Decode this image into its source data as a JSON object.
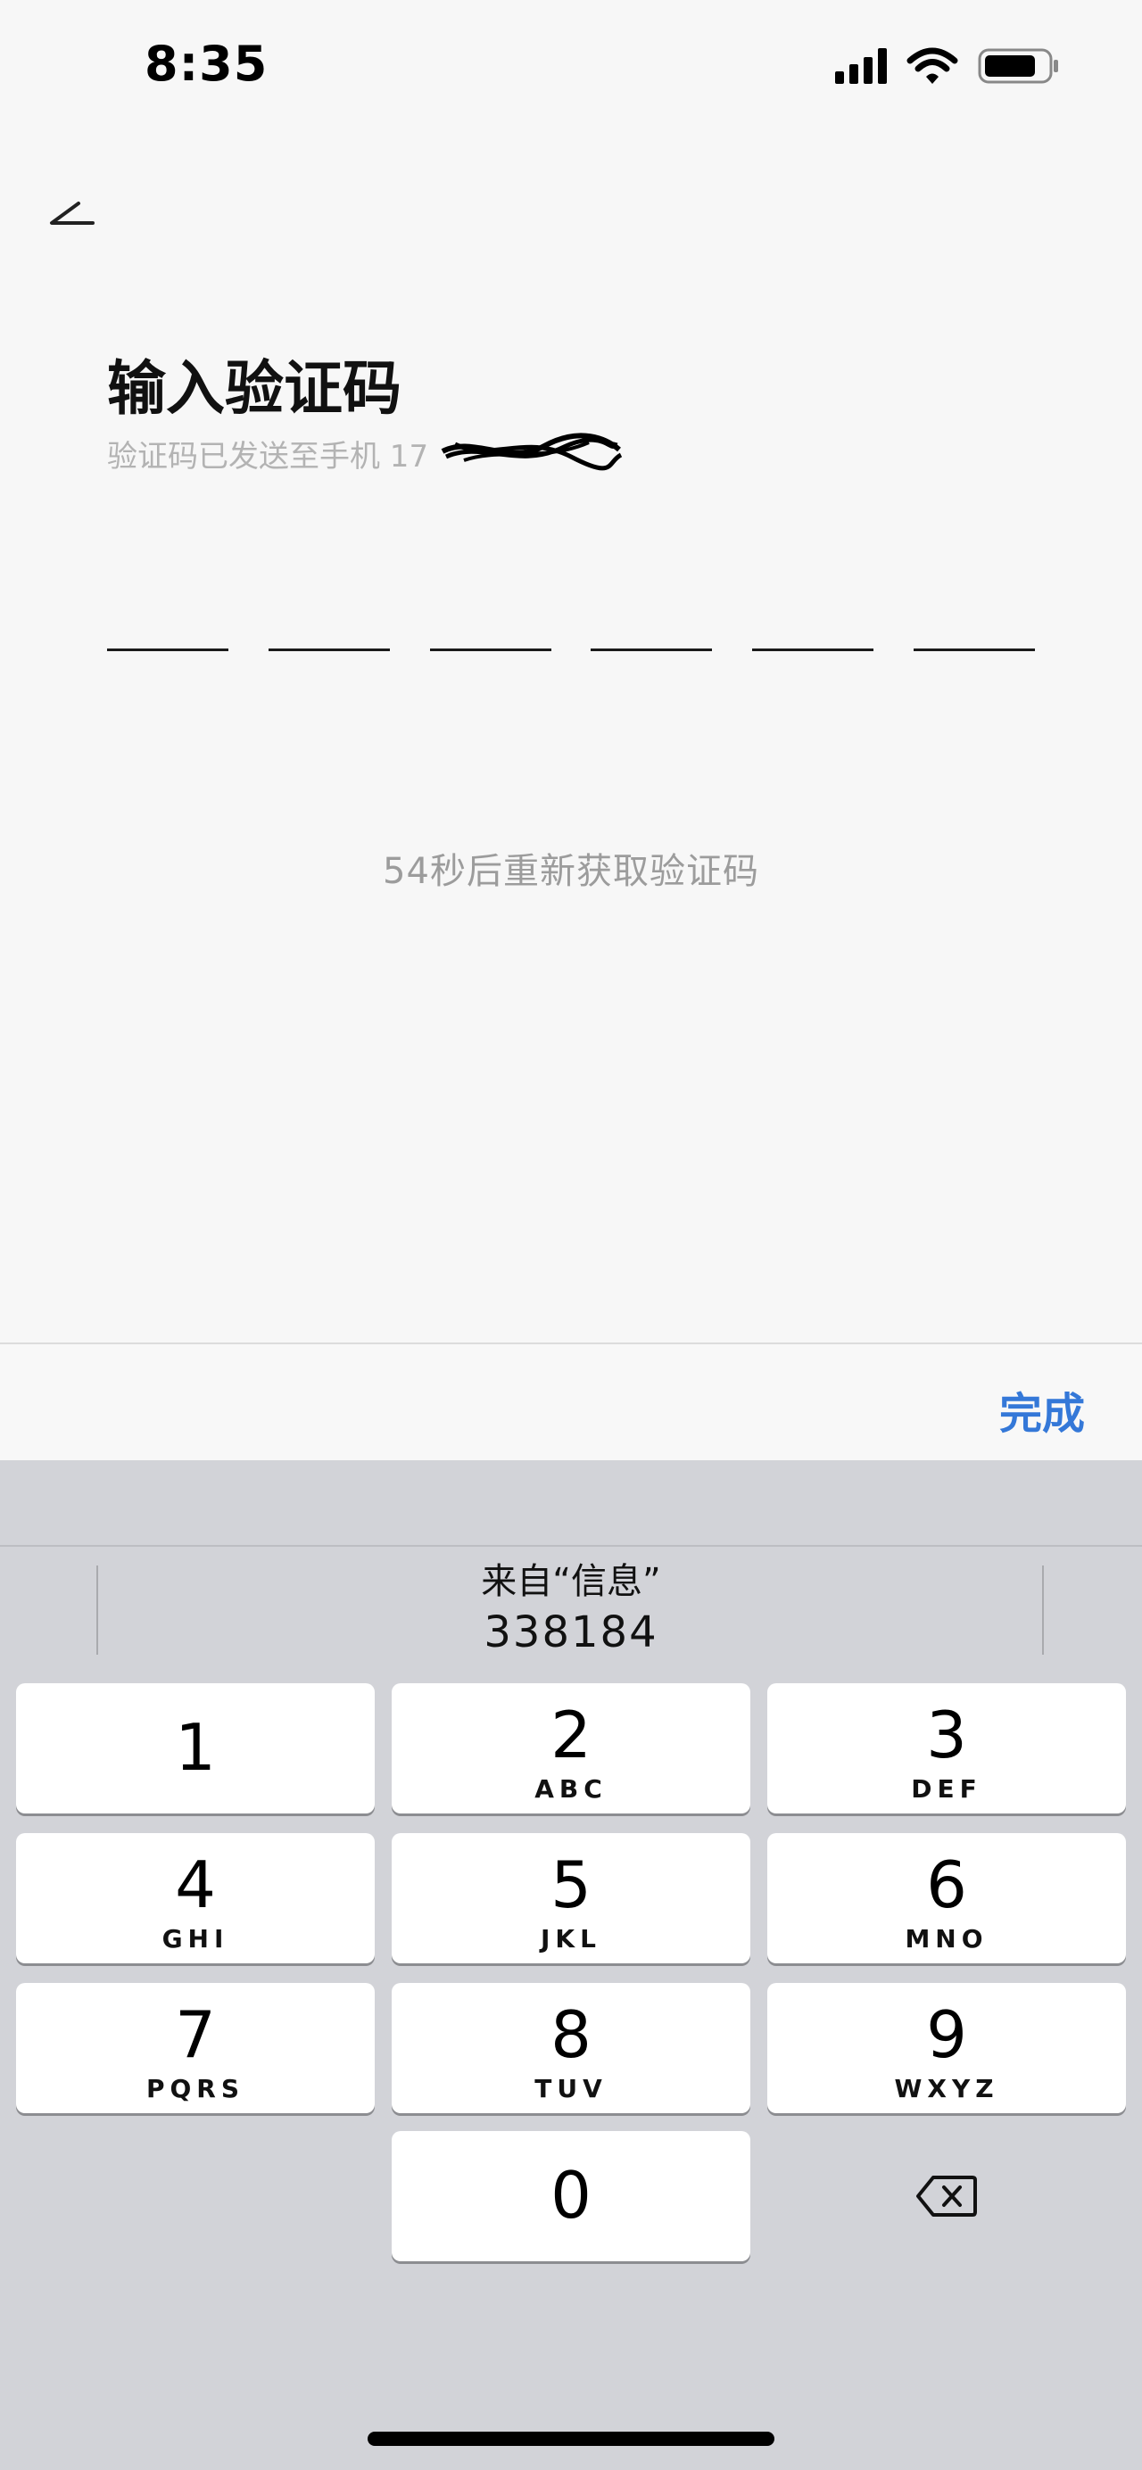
{
  "status_bar": {
    "time": "8:35"
  },
  "header": {
    "back_label": "<"
  },
  "page": {
    "title": "输入验证码",
    "subtitle": "验证码已发送至手机 17",
    "code_slot_count": 6,
    "resend_text": "54秒后重新获取验证码"
  },
  "toolbar": {
    "done_label": "完成"
  },
  "keyboard": {
    "suggestion_source": "来自“信息”",
    "suggestion_code": "338184",
    "keys": [
      {
        "num": "1",
        "letters": ""
      },
      {
        "num": "2",
        "letters": "ABC"
      },
      {
        "num": "3",
        "letters": "DEF"
      },
      {
        "num": "4",
        "letters": "GHI"
      },
      {
        "num": "5",
        "letters": "JKL"
      },
      {
        "num": "6",
        "letters": "MNO"
      },
      {
        "num": "7",
        "letters": "PQRS"
      },
      {
        "num": "8",
        "letters": "TUV"
      },
      {
        "num": "9",
        "letters": "WXYZ"
      },
      {
        "num": "0",
        "letters": ""
      }
    ],
    "delete_icon": "backspace-icon"
  },
  "colors": {
    "accent": "#3478d8",
    "background": "#f7f7f7",
    "keyboard_bg": "#d2d3d8"
  }
}
